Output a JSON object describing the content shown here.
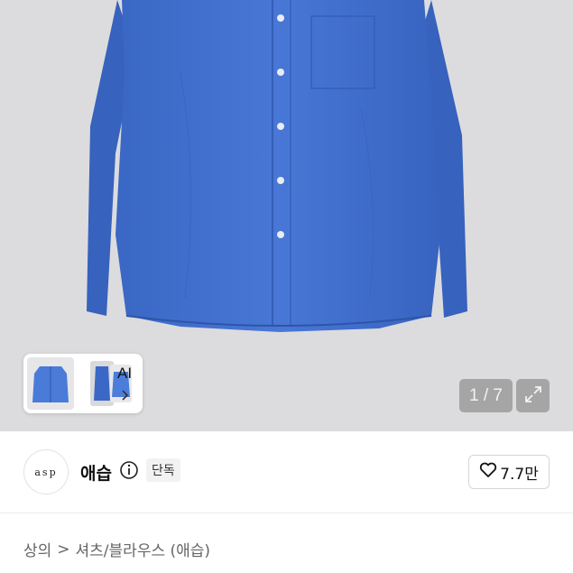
{
  "gallery": {
    "counter": "1 / 7",
    "ai_label": "AI",
    "thumbnails": [
      "front-shirt",
      "side-shirt",
      "folded-shirt"
    ],
    "colors": {
      "shirt": "#3f6fcd",
      "background": "#dcdcde"
    }
  },
  "shop": {
    "logo_text": "asp",
    "name": "애습",
    "badge": "단독",
    "likes": "7.7만"
  },
  "breadcrumb": {
    "category": "상의",
    "separator": ">",
    "subcategory": "셔츠/블라우스 (애습)"
  },
  "icons": {
    "expand": "expand-icon",
    "info": "info-icon",
    "heart": "heart-icon",
    "chevron": "chevron-right-icon"
  }
}
